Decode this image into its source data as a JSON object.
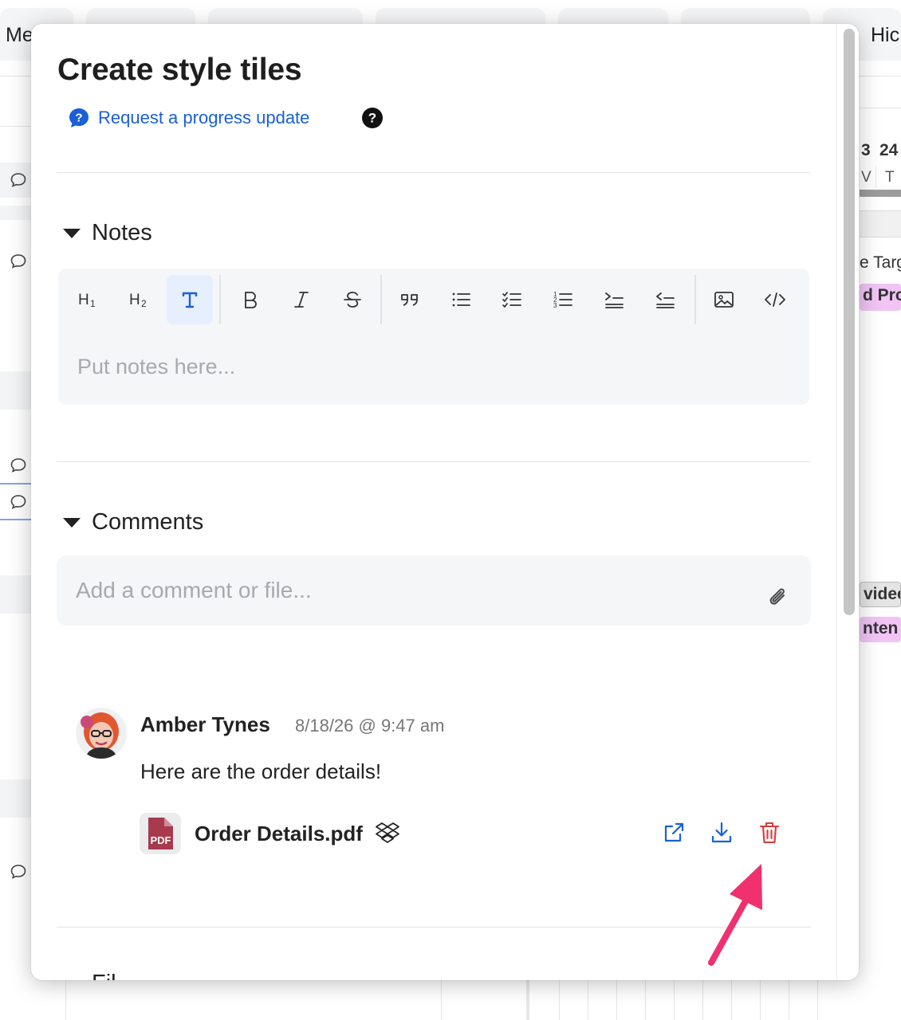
{
  "background": {
    "tabs": [
      {
        "label": "Me"
      },
      {
        "label": "Hic"
      }
    ],
    "timeline": {
      "dates": [
        "3",
        "24"
      ],
      "days": [
        "V",
        "T"
      ],
      "row_labels": [
        "e Targ",
        "d Pro",
        "videc",
        "nten"
      ]
    }
  },
  "modal": {
    "title": "Create style tiles",
    "request_update_label": "Request a progress update",
    "notes": {
      "section_label": "Notes",
      "placeholder": "Put notes here...",
      "toolbar": [
        {
          "name": "heading1-icon"
        },
        {
          "name": "heading2-icon"
        },
        {
          "name": "text-icon",
          "active": true
        },
        {
          "name": "bold-icon"
        },
        {
          "name": "italic-icon"
        },
        {
          "name": "strikethrough-icon"
        },
        {
          "name": "quote-icon"
        },
        {
          "name": "bullet-list-icon"
        },
        {
          "name": "checklist-icon"
        },
        {
          "name": "numbered-list-icon"
        },
        {
          "name": "indent-icon"
        },
        {
          "name": "outdent-icon"
        },
        {
          "name": "image-icon"
        },
        {
          "name": "code-icon"
        }
      ]
    },
    "comments": {
      "section_label": "Comments",
      "placeholder": "Add a comment or file...",
      "items": [
        {
          "author": "Amber Tynes",
          "timestamp": "8/18/26 @ 9:47 am",
          "text": "Here are the order details!",
          "attachment": {
            "file_name": "Order Details.pdf",
            "file_type": "PDF"
          }
        }
      ]
    },
    "next_section_label": "Fil"
  },
  "colors": {
    "link_blue": "#1a5fd6",
    "delete_red": "#d93b3b",
    "arrow_pink": "#f0306f",
    "pdf_red": "#a83a4e",
    "editor_bg": "#f5f6f8",
    "toolbar_active_bg": "#e6effd"
  }
}
